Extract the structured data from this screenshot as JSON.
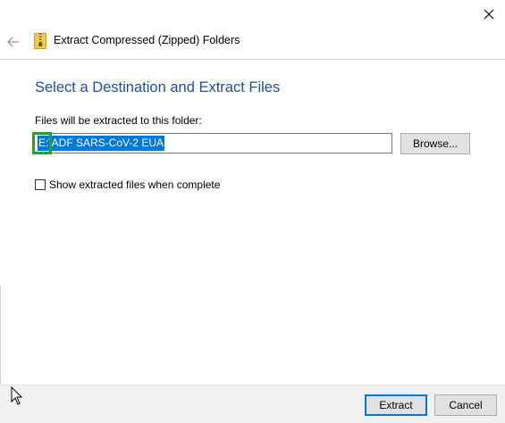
{
  "window": {
    "title": "Extract Compressed (Zipped) Folders",
    "close_icon": "close-icon",
    "back_icon": "back-arrow-icon",
    "folder_icon": "zipped-folder-icon"
  },
  "main": {
    "heading": "Select a Destination and Extract Files",
    "destination_label": "Files will be extracted to this folder:",
    "destination_value": "E:\\ADF SARS-CoV-2 EUA",
    "browse_label": "Browse...",
    "show_files_label": "Show extracted files when complete",
    "show_files_checked": false
  },
  "footer": {
    "extract_label": "Extract",
    "cancel_label": "Cancel"
  },
  "colors": {
    "heading": "#1d4f9c",
    "selection": "#0078d7",
    "focus_highlight": "#2e9b3a",
    "footer_bg": "#f0f0f0"
  }
}
